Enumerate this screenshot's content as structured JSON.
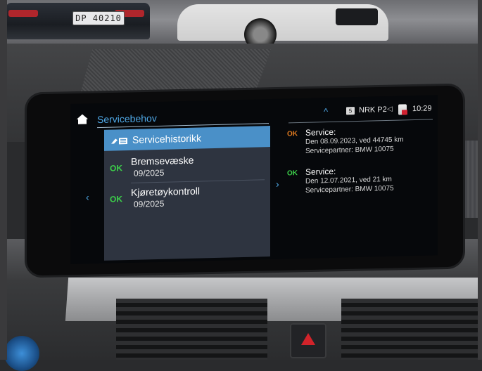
{
  "background": {
    "plate_text": "DP 40210"
  },
  "header": {
    "title": "Servicebehov",
    "home_icon": "home-icon",
    "radio_badge": "5",
    "radio_station": "NRK P2",
    "speaker_icon": "speaker-icon",
    "phone_icon": "phone-icon",
    "time": "10:29",
    "scroll_up_icon": "^"
  },
  "navigation": {
    "left_arrow": "‹",
    "right_arrow": "›"
  },
  "list": {
    "selected": {
      "label": "Servicehistorikk",
      "icon": "service-history-icon"
    },
    "items": [
      {
        "status": "OK",
        "title": "Bremsevæske",
        "date": "09/2025"
      },
      {
        "status": "OK",
        "title": "Kjøretøykontroll",
        "date": "09/2025"
      }
    ]
  },
  "details": [
    {
      "status": "OK",
      "status_color": "#e07a1f",
      "title": "Service:",
      "line1": "Den 08.09.2023, ved 44745 km",
      "line2": "Servicepartner: BMW 10075"
    },
    {
      "status": "OK",
      "status_color": "#3cd04a",
      "title": "Service:",
      "line1": "Den 12.07.2021, ved 21 km",
      "line2": "Servicepartner: BMW 10075"
    }
  ],
  "colors": {
    "accent": "#4fa8e6",
    "selection": "#4a90c8",
    "ok_green": "#3cd04a",
    "ok_orange": "#e07a1f"
  }
}
